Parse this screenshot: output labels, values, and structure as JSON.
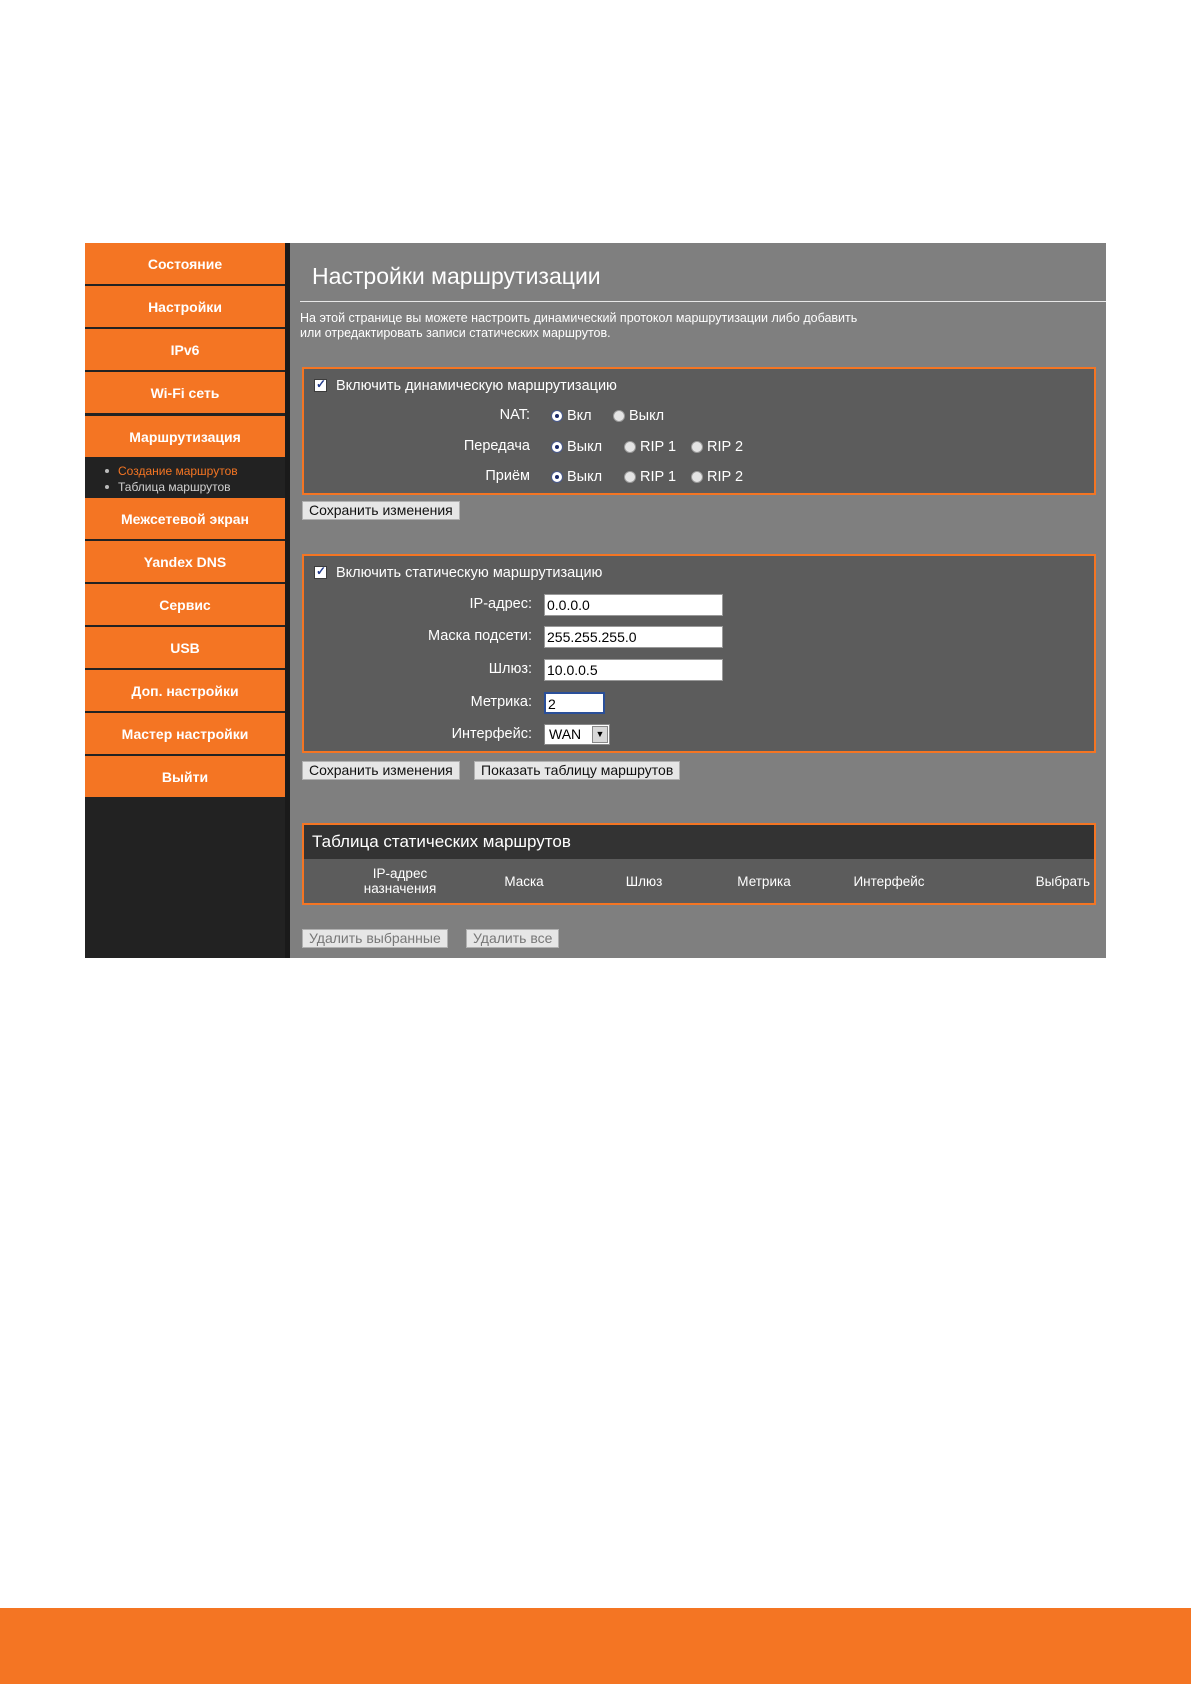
{
  "sidebar": {
    "items": [
      {
        "label": "Состояние"
      },
      {
        "label": "Настройки"
      },
      {
        "label": "IPv6"
      },
      {
        "label": "Wi-Fi сеть"
      },
      {
        "label": "Маршрутизация"
      },
      {
        "label": "Межсетевой экран"
      },
      {
        "label": "Yandex DNS"
      },
      {
        "label": "Сервис"
      },
      {
        "label": "USB"
      },
      {
        "label": "Доп. настройки"
      },
      {
        "label": "Мастер настройки"
      },
      {
        "label": "Выйти"
      }
    ],
    "submenu": [
      {
        "label": "Создание маршрутов",
        "active": true
      },
      {
        "label": "Таблица маршрутов",
        "active": false
      }
    ]
  },
  "main": {
    "title": "Настройки маршрутизации",
    "description_line1": "На этой странице вы можете настроить динамический протокол маршрутизации либо добавить",
    "description_line2": "или отредактировать записи статических маршрутов."
  },
  "dynamic": {
    "enable_label": "Включить динамическую маршрутизацию",
    "enabled": true,
    "nat_label": "NAT:",
    "nat_on": "Вкл",
    "nat_off": "Выкл",
    "nat_selected": "Вкл",
    "send_label": "Передача",
    "recv_label": "Приём",
    "opt_off": "Выкл",
    "opt_rip1": "RIP 1",
    "opt_rip2": "RIP 2",
    "send_selected": "Выкл",
    "recv_selected": "Выкл",
    "save_label": "Сохранить изменения"
  },
  "static": {
    "enable_label": "Включить статическую маршрутизацию",
    "enabled": true,
    "ip_label": "IP-адрес:",
    "ip_value": "0.0.0.0",
    "mask_label": "Маска подсети:",
    "mask_value": "255.255.255.0",
    "gw_label": "Шлюз:",
    "gw_value": "10.0.0.5",
    "metric_label": "Метрика:",
    "metric_value": "2",
    "iface_label": "Интерфейс:",
    "iface_value": "WAN",
    "save_label": "Сохранить изменения",
    "show_table_label": "Показать таблицу маршрутов"
  },
  "routes": {
    "title": "Таблица статических маршрутов",
    "columns": [
      "IP-адрес назначения",
      "Маска",
      "Шлюз",
      "Метрика",
      "Интерфейс",
      "Выбрать"
    ],
    "col_ip_line1": "IP-адрес",
    "col_ip_line2": "назначения",
    "delete_selected_label": "Удалить выбранные",
    "delete_all_label": "Удалить все"
  },
  "colors": {
    "accent": "#f47523",
    "sidebar_bg": "#222222",
    "content_bg": "#7f7f7f",
    "panel_bg": "#5c5c5c"
  }
}
